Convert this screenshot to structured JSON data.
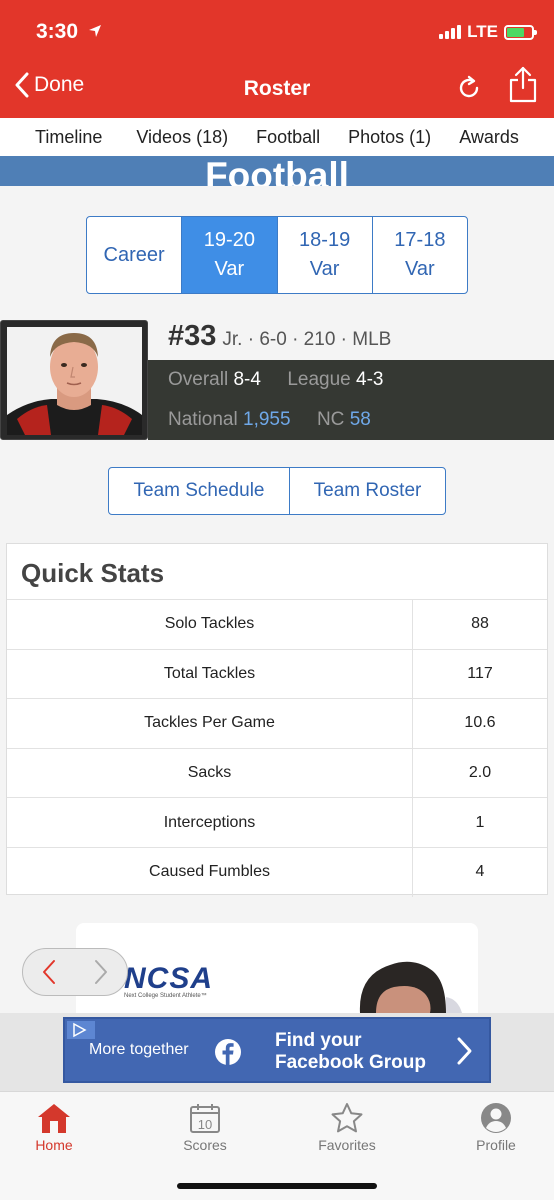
{
  "status_bar": {
    "time": "3:30",
    "network": "LTE",
    "battery_level": 0.7
  },
  "nav": {
    "back_label": "Done",
    "title": "Roster",
    "refresh_icon": "refresh-icon",
    "share_icon": "share-icon"
  },
  "tabs": [
    {
      "label": "Timeline"
    },
    {
      "label": "Videos (18)"
    },
    {
      "label": "Football"
    },
    {
      "label": "Photos (1)"
    },
    {
      "label": "Awards"
    }
  ],
  "section_title": "Football",
  "seasons": [
    {
      "line1": "Career",
      "line2": "",
      "active": false
    },
    {
      "line1": "19-20",
      "line2": "Var",
      "active": true
    },
    {
      "line1": "18-19",
      "line2": "Var",
      "active": false
    },
    {
      "line1": "17-18",
      "line2": "Var",
      "active": false
    }
  ],
  "player": {
    "number": "#33",
    "meta": "Jr. · 6-0 · 210 · MLB",
    "overall_label": "Overall",
    "overall_value": "8-4",
    "league_label": "League",
    "league_value": "4-3",
    "national_label": "National",
    "national_value": "1,955",
    "nc_label": "NC",
    "nc_value": "58"
  },
  "links": {
    "schedule": "Team Schedule",
    "roster": "Team Roster"
  },
  "quick_stats": {
    "title": "Quick Stats",
    "rows": [
      {
        "label": "Solo Tackles",
        "value": "88"
      },
      {
        "label": "Total Tackles",
        "value": "117"
      },
      {
        "label": "Tackles Per Game",
        "value": "10.6"
      },
      {
        "label": "Sacks",
        "value": "2.0"
      },
      {
        "label": "Interceptions",
        "value": "1"
      },
      {
        "label": "Caused Fumbles",
        "value": "4"
      }
    ]
  },
  "ad": {
    "brand": "NCSA",
    "tagline": "Next College Student Athlete™"
  },
  "fb_banner": {
    "lead": "More together",
    "cta_line1": "Find your",
    "cta_line2": "Facebook Group"
  },
  "tabbar": [
    {
      "label": "Home",
      "icon": "home-icon",
      "active": true
    },
    {
      "label": "Scores",
      "icon": "calendar-icon",
      "active": false
    },
    {
      "label": "Favorites",
      "icon": "star-icon",
      "active": false
    },
    {
      "label": "Profile",
      "icon": "profile-icon",
      "active": false
    }
  ],
  "colors": {
    "brand_red": "#e2362a",
    "accent_blue": "#3d7bc6",
    "active_blue": "#3f8ee6",
    "facebook_blue": "#4267b2"
  }
}
